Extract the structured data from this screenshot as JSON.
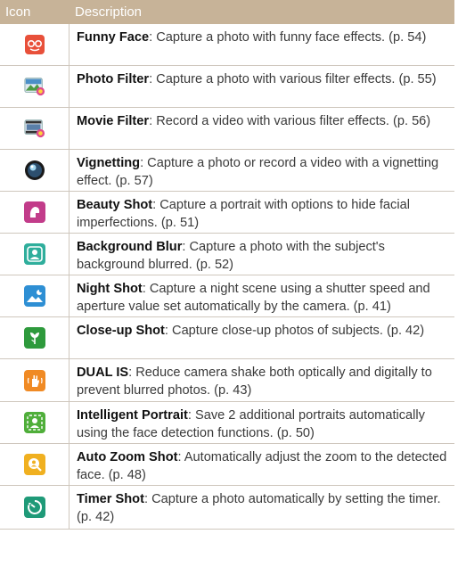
{
  "header": {
    "col_icon": "Icon",
    "col_desc": "Description"
  },
  "rows": [
    {
      "name": "Funny Face",
      "text": ": Capture a photo with funny face effects. (p. 54)",
      "icon": "funny-face-icon",
      "color": "#e8503a"
    },
    {
      "name": "Photo Filter",
      "text": ": Capture a photo with various filter effects. (p. 55)",
      "icon": "photo-filter-icon",
      "color": "#4b90c8"
    },
    {
      "name": "Movie Filter",
      "text": ": Record a video with various filter effects. (p. 56)",
      "icon": "movie-filter-icon",
      "color": "#5a7fa8"
    },
    {
      "name": "Vignetting",
      "text": ": Capture a photo or record a video with a vignetting effect. (p. 57)",
      "icon": "vignetting-icon",
      "color": "#2d4f6e"
    },
    {
      "name": "Beauty Shot",
      "text": ": Capture a portrait with options to hide facial imperfections. (p. 51)",
      "icon": "beauty-shot-icon",
      "color": "#c23c8a"
    },
    {
      "name": "Background Blur",
      "text": ": Capture a photo with the subject's background blurred. (p. 52)",
      "icon": "background-blur-icon",
      "color": "#2fae9c"
    },
    {
      "name": "Night Shot",
      "text": ": Capture a night scene using a shutter speed and aperture value set automatically by the camera. (p. 41)",
      "icon": "night-shot-icon",
      "color": "#2e8fd4"
    },
    {
      "name": "Close-up Shot",
      "text": ": Capture close-up photos of subjects. (p. 42)",
      "icon": "close-up-shot-icon",
      "color": "#2e9a3c"
    },
    {
      "name": "DUAL IS",
      "text": ": Reduce camera shake both optically and digitally to prevent blurred photos. (p. 43)",
      "icon": "dual-is-icon",
      "color": "#f08a24"
    },
    {
      "name": "Intelligent Portrait",
      "text": ": Save 2 additional portraits automatically using the face detection functions. (p. 50)",
      "icon": "intelligent-portrait-icon",
      "color": "#4fae3a"
    },
    {
      "name": "Auto Zoom Shot",
      "text": ": Automatically adjust the zoom to the detected face. (p. 48)",
      "icon": "auto-zoom-shot-icon",
      "color": "#f0b020"
    },
    {
      "name": "Timer Shot",
      "text": ": Capture a photo automatically by setting the timer. (p. 42)",
      "icon": "timer-shot-icon",
      "color": "#1f9a78"
    }
  ]
}
